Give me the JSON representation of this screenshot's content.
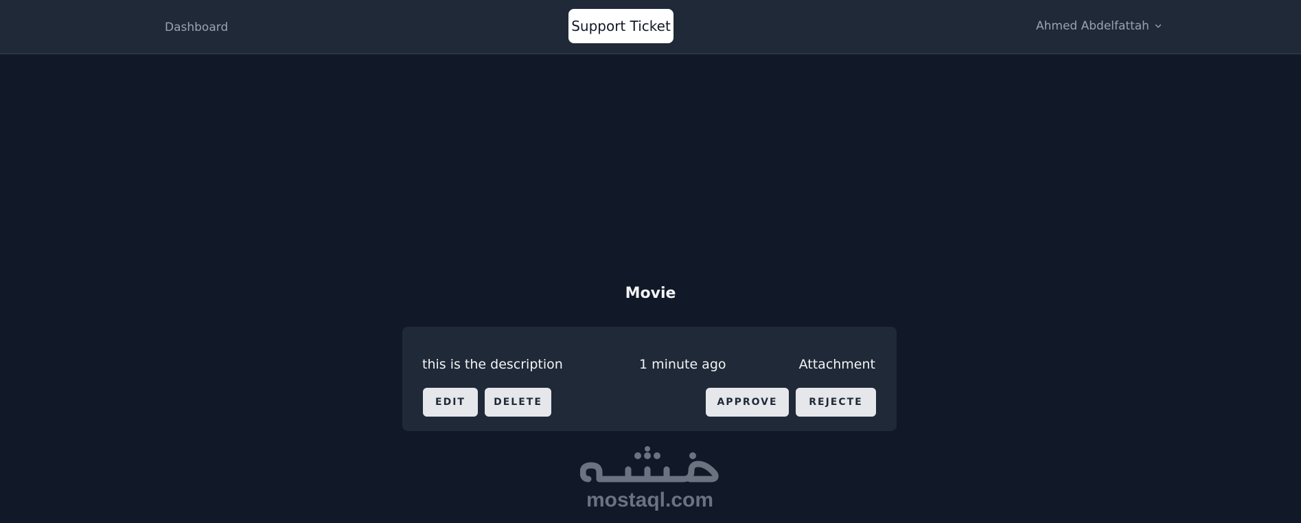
{
  "nav": {
    "dashboard_label": "Dashboard",
    "brand_label": "Support Ticket",
    "user_name": "Ahmed Abdelfattah"
  },
  "page": {
    "title": "Movie"
  },
  "ticket": {
    "description": "this is the description",
    "time": "1 minute ago",
    "attachment_label": "Attachment",
    "actions": {
      "edit": "EDIT",
      "delete": "DELETE",
      "approve": "APPROVE",
      "reject": "REJECTE"
    }
  },
  "watermark": {
    "logo_text": "مستقل",
    "site": "mostaql.com"
  },
  "colors": {
    "page_bg": "#111827",
    "nav_bg": "#1f2937",
    "card_bg": "#1f2937",
    "button_bg": "#e5e7eb",
    "watermark": "#6b7280"
  }
}
